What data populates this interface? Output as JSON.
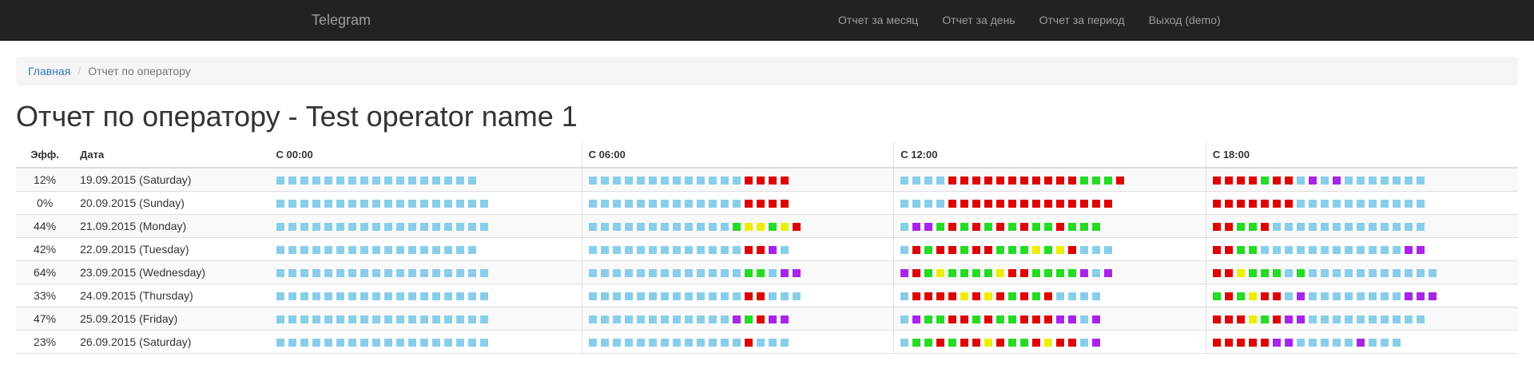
{
  "navbar": {
    "brand": "Telegram",
    "links": [
      "Отчет за месяц",
      "Отчет за день",
      "Отчет за период",
      "Выход (demo)"
    ]
  },
  "breadcrumb": {
    "home": "Главная",
    "current": "Отчет по оператору"
  },
  "page_title": "Отчет по оператору - Test operator name 1",
  "table": {
    "headers": [
      "Эфф.",
      "Дата",
      "С 00:00",
      "С 06:00",
      "С 12:00",
      "С 18:00"
    ],
    "legend_colors": {
      "b": "#87ceeb",
      "r": "#e00000",
      "g": "#22dd22",
      "y": "#eeee00",
      "p": "#aa22ee"
    },
    "rows": [
      {
        "eff": "12%",
        "date": "19.09.2015 (Saturday)",
        "blocks": [
          "bbbbbbbbbbbbbbbbb",
          "bbbbbbbbbbbbbrrrr",
          "bbbbrrrrrrrrrrrgggr",
          "rrrrgrrbpbpbbbbbbb"
        ]
      },
      {
        "eff": "0%",
        "date": "20.09.2015 (Sunday)",
        "blocks": [
          "bbbbbbbbbbbbbbbbbb",
          "bbbbbbbbbbbbbrrrr",
          "bbbbrrrrrrrrrrrrrr",
          "rrrrrrrbbbbbbbbbbb"
        ]
      },
      {
        "eff": "44%",
        "date": "21.09.2015 (Monday)",
        "blocks": [
          "bbbbbbbbbbbbbbbbbb",
          "bbbbbbbbbbbbgyygyr",
          "bppgrgrgrgrggrggg",
          "rrggrbbbbbbbbbbbbb"
        ]
      },
      {
        "eff": "42%",
        "date": "22.09.2015 (Tuesday)",
        "blocks": [
          "bbbbbbbbbbbbbbbbb",
          "bbbbbbbbbbbbbrrpb",
          "brgrrgrrgggygyrbbb",
          "rrggbbbbbbbbbbbbpp"
        ]
      },
      {
        "eff": "64%",
        "date": "23.09.2015 (Wednesday)",
        "blocks": [
          "bbbbbbbbbbbbbbbbbb",
          "bbbbbbbbbbbbbggbpp",
          "prgyggggyrrggggpbp",
          "rrygggbgbbbbbbbbbbb"
        ]
      },
      {
        "eff": "33%",
        "date": "24.09.2015 (Thursday)",
        "blocks": [
          "bbbbbbbbbbbbbbbbbb",
          "bbbbbbbbbbbbbrrbbb",
          "brrrryryrgrgrbbbb",
          "grgyrrbpbbbbbbbbppp"
        ]
      },
      {
        "eff": "47%",
        "date": "25.09.2015 (Friday)",
        "blocks": [
          "bbbbbbbbbbbbbbbbbb",
          "bbbbbbbbbbbbpgrpp",
          "bpggrrgrggrrrppbp",
          "rrrygrppbbbbbbbbbb"
        ]
      },
      {
        "eff": "23%",
        "date": "26.09.2015 (Saturday)",
        "blocks": [
          "bbbbbbbbbbbbbbbbbb",
          "bbbbbbbbbbbbbrbbb",
          "bggrgrryrggryrrbp",
          "rrrrrppbbbbbpbbb"
        ]
      }
    ]
  }
}
